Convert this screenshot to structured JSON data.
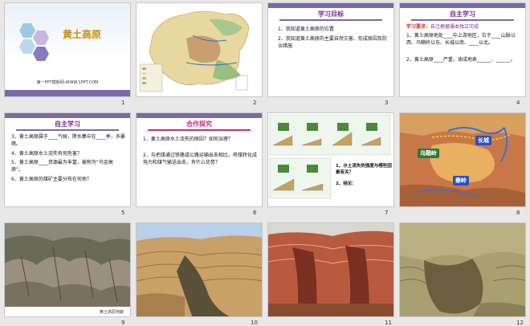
{
  "slides": [
    {
      "num": "1",
      "title": "黄土高原",
      "footer": "第一PPT模板网-WWW.1PPT.COM"
    },
    {
      "num": "2"
    },
    {
      "num": "3",
      "title": "学习目标",
      "items": [
        "1．我知道黄土高原的位置",
        "2．我知道黄土高原的主要自然灾害、形成原因及防治措施"
      ]
    },
    {
      "num": "4",
      "title": "自主学习",
      "req_label": "学习要求：",
      "req_text": "自己根据课本独立完成",
      "items": [
        "1．黄土高原地处____中上游地区，位于____山脉以西、乌鞘岭以东、长城以南、____以北。",
        "2．黄土高原____严重，读成地表______、______。"
      ]
    },
    {
      "num": "5",
      "title": "自主学习",
      "items": [
        "3．黄土高原属于____气候，降水集中在____季，多暴雨。",
        "4．黄土高原水土流失有何危害？",
        "5．黄土高原____资源最为丰富，被称为“乌金高原”。",
        "6．黄土高原的煤矿主要分布在何地？"
      ]
    },
    {
      "num": "6",
      "title": "合作探究",
      "items": [
        "1．黄土高原水土流失的原因？如何治理？",
        "2．与把煤通过铁路或公路运输出去相比，将煤转化成电力和煤气输送出去，有什么优势？"
      ]
    },
    {
      "num": "7",
      "q1": "1、水土流失的强度与哪些因素有关？",
      "q2": "2、结论："
    },
    {
      "num": "8",
      "labels": {
        "left": "乌鞘岭",
        "top": "长城",
        "bottom": "秦岭"
      }
    },
    {
      "num": "9",
      "caption": "黄土高原地貌"
    },
    {
      "num": "10"
    },
    {
      "num": "11"
    },
    {
      "num": "12"
    }
  ],
  "colors": {
    "accent": "#7a6aa8",
    "title": "#7a2a8a",
    "red": "#d0302a"
  }
}
